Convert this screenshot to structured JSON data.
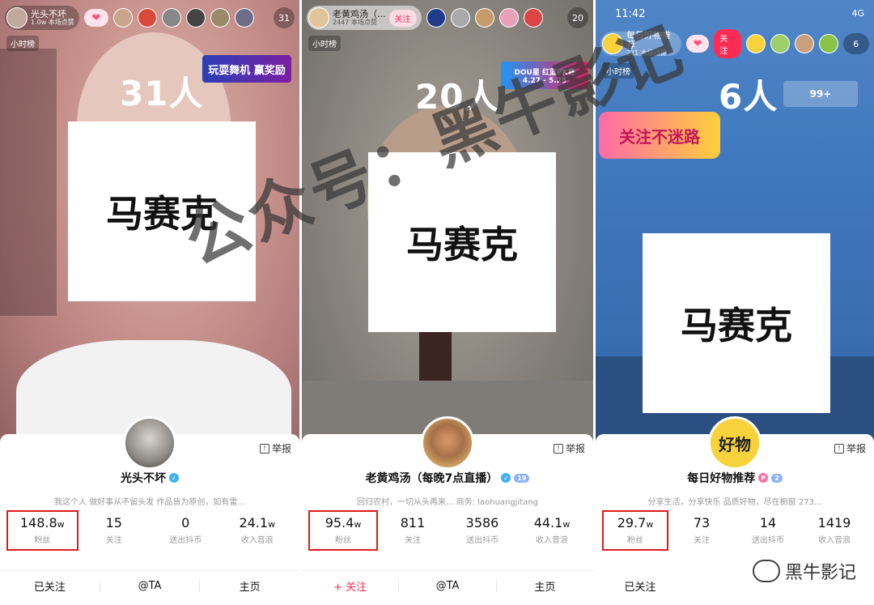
{
  "panels": [
    {
      "host_name": "光头不坏",
      "host_sub": "1.0w 本场点赞",
      "viewer_count": "31",
      "hour_label": "小时榜",
      "big_count": "31人",
      "promo_text": "玩耍舞机 赢奖励",
      "mosaic_text": "马赛克",
      "report": "举报",
      "name": "光头不坏",
      "bio": "我这个人 做好事从不留头发 作品皆为原创，如有雷...",
      "stats": [
        {
          "value": "148.8",
          "unit": "w",
          "label": "粉丝"
        },
        {
          "value": "15",
          "unit": "",
          "label": "关注"
        },
        {
          "value": "0",
          "unit": "",
          "label": "送出抖币"
        },
        {
          "value": "24.1",
          "unit": "w",
          "label": "收入音浪"
        }
      ],
      "actions": [
        "已关注",
        "@TA",
        "主页"
      ]
    },
    {
      "host_name": "老黄鸡汤（...",
      "host_sub": "2447 本场点赞",
      "follow_label": "关注",
      "viewer_count": "20",
      "hour_label": "小时榜",
      "big_count": "20人",
      "promo_text": "DOU星 红蓝PK赛",
      "promo_date": "4.27 - 5.25",
      "mosaic_text": "马赛克",
      "report": "举报",
      "name": "老黄鸡汤（每晚7点直播）",
      "level": "19",
      "bio": "回归农村，一切从头再来... 商务: laohuangjitang",
      "stats": [
        {
          "value": "95.4",
          "unit": "w",
          "label": "粉丝"
        },
        {
          "value": "811",
          "unit": "",
          "label": "关注"
        },
        {
          "value": "3586",
          "unit": "",
          "label": "送出抖币"
        },
        {
          "value": "44.1",
          "unit": "w",
          "label": "收入音浪"
        }
      ],
      "actions": [
        "+ 关注",
        "@TA",
        "主页"
      ]
    },
    {
      "time": "11:42",
      "network": "4G",
      "host_name": "每日好物推荐",
      "host_sub": "221 本场点赞",
      "follow_label": "关注",
      "viewer_count": "6",
      "hour_label": "小时榜",
      "big_count": "6人",
      "promo_text": "关注不迷路",
      "rank_text": "99+",
      "mosaic_text": "马赛克",
      "avatar_text": "好物",
      "report": "举报",
      "name": "每日好物推荐",
      "level": "2",
      "bio": "分享生活，分享快乐 品质好物，尽在橱窗 273...",
      "stats": [
        {
          "value": "29.7",
          "unit": "w",
          "label": "粉丝"
        },
        {
          "value": "73",
          "unit": "",
          "label": "关注"
        },
        {
          "value": "14",
          "unit": "",
          "label": "送出抖币"
        },
        {
          "value": "1419",
          "unit": "",
          "label": "收入音浪"
        }
      ],
      "actions": [
        "已关注",
        "",
        ""
      ]
    }
  ],
  "watermark": "公众号：黑牛影记",
  "wechat_label": "黑牛影记",
  "colors": {
    "highlight": "#e01a1a",
    "accent": "#fe2c55",
    "verified": "#3fb2f0"
  }
}
